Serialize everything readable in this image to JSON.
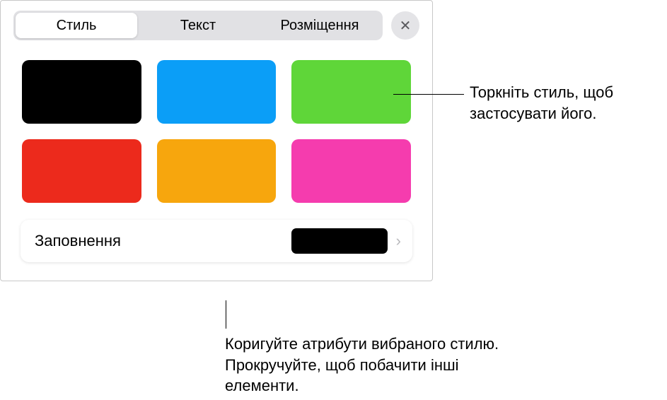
{
  "tabs": {
    "style": "Стиль",
    "text": "Текст",
    "arrange": "Розміщення"
  },
  "swatches": [
    {
      "color": "#000000"
    },
    {
      "color": "#0b9ef7"
    },
    {
      "color": "#5fd639"
    },
    {
      "color": "#ec2a1c"
    },
    {
      "color": "#f7a60d"
    },
    {
      "color": "#f53cae"
    }
  ],
  "fill": {
    "label": "Заповнення",
    "color": "#000000"
  },
  "callouts": {
    "apply_style": "Торкніть стиль, щоб застосувати його.",
    "adjust_attrs": "Коригуйте атрибути вибраного стилю. Прокручуйте, щоб побачити інші елементи."
  }
}
